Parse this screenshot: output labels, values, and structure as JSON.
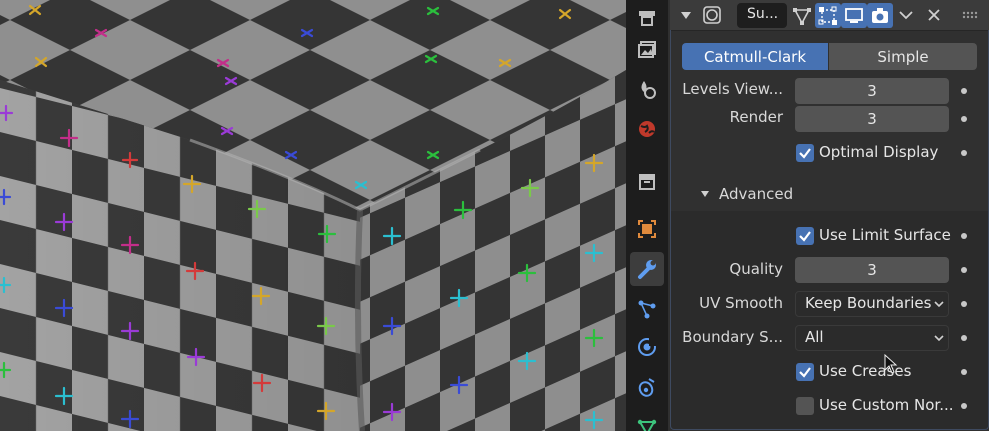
{
  "panel": {
    "modifier_name": "Su...",
    "subdivision_types": [
      "Catmull-Clark",
      "Simple"
    ],
    "active_type": "Catmull-Clark",
    "levels_viewport": {
      "label": "Levels View...",
      "value": "3"
    },
    "render": {
      "label": "Render",
      "value": "3"
    },
    "optimal_display": {
      "label": "Optimal Display",
      "checked": true
    },
    "advanced": {
      "title": "Advanced",
      "use_limit_surface": {
        "label": "Use Limit Surface",
        "checked": true
      },
      "quality": {
        "label": "Quality",
        "value": "3"
      },
      "uv_smooth": {
        "label": "UV Smooth",
        "value": "Keep Boundaries"
      },
      "boundary_smooth": {
        "label": "Boundary S...",
        "value": "All"
      },
      "use_creases": {
        "label": "Use Creases",
        "checked": true
      },
      "use_custom_normals": {
        "label": "Use Custom Nor...",
        "checked": false
      }
    }
  },
  "icons": {
    "header": [
      "collapse-arrow-icon",
      "modifier-type-icon",
      "edit-mode-icon",
      "cage-icon",
      "viewport-display-icon",
      "render-icon",
      "dropdown-icon",
      "close-icon",
      "drag-handle-icon"
    ],
    "tabs": [
      "tool-tab-icon",
      "render-tab-icon",
      "output-tab-icon",
      "view-layer-tab-icon",
      "scene-tab-icon",
      "world-tab-icon",
      "collection-tab-icon",
      "object-tab-icon",
      "modifier-tab-icon",
      "particles-tab-icon",
      "physics-tab-icon",
      "constraints-tab-icon",
      "data-tab-icon"
    ]
  },
  "colors": {
    "accent": "#4772b3",
    "panel_bg": "#303030",
    "field_bg": "#545454",
    "tab_bg": "#1d1d1d",
    "checker_light": "#9a9a9a",
    "checker_dark": "#333333"
  }
}
